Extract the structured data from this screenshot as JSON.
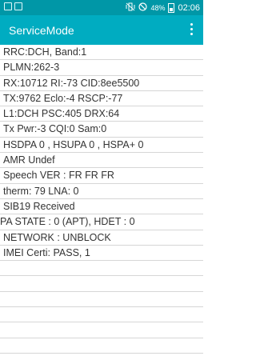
{
  "status_bar": {
    "battery_percent": "48%",
    "time": "02:06",
    "icons": [
      "notification-icon",
      "notification-icon",
      "vibrate-mute-icon",
      "do-not-disturb-icon",
      "battery-icon"
    ]
  },
  "app_bar": {
    "title": "ServiceMode",
    "menu_icon": "more-vert-icon"
  },
  "rows": [
    "RRC:DCH, Band:1",
    "PLMN:262-3",
    "RX:10712 RI:-73 CID:8ee5500",
    "TX:9762 Eclo:-4 RSCP:-77",
    "L1:DCH PSC:405 DRX:64",
    "Tx Pwr:-3 CQI:0 Sam:0",
    "HSDPA 0 , HSUPA 0 , HSPA+ 0",
    "AMR Undef",
    "Speech VER : FR FR FR",
    "therm: 79 LNA: 0",
    "SIB19 Received",
    "PA STATE : 0 (APT), HDET : 0",
    "NETWORK : UNBLOCK",
    "IMEI Certi: PASS, 1",
    "",
    "",
    "",
    "",
    "",
    ""
  ]
}
